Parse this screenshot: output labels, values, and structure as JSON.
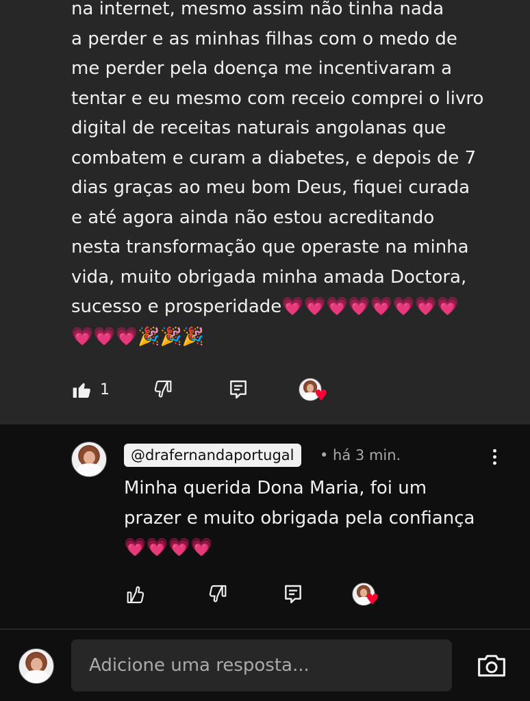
{
  "comment": {
    "text": "na internet, mesmo assim não tinha nada\na perder e as minhas filhas com o medo de\nme perder pela doença me incentivaram a\ntentar e eu mesmo com receio comprei o livro\ndigital de receitas naturais angolanas que\ncombatem e curam a diabetes, e depois de 7\ndias graças ao meu bom Deus, fiquei curada\ne até agora ainda não estou acreditando\nnesta transformação que operaste na minha\nvida, muito obrigada minha amada Doctora,\nsucesso e prosperidade💗💗💗💗💗💗💗💗\n💗💗💗🎉🎉🎉",
    "like_count": "1",
    "icons": [
      "thumbs-up-filled-icon",
      "thumbs-down-icon",
      "reply-comment-icon",
      "creator-heart-avatar"
    ]
  },
  "reply": {
    "handle": "@drafernandaportugal",
    "meta": "• há 3 min.",
    "text": "Minha querida Dona Maria, foi um\nprazer e muito obrigada pela confiança\n💗💗💗💗",
    "icons": [
      "thumbs-up-icon",
      "thumbs-down-icon",
      "reply-comment-icon",
      "creator-heart-avatar"
    ]
  },
  "reply_bar": {
    "placeholder": "Adicione uma resposta..."
  },
  "colors": {
    "background": "#0f0f0f",
    "highlight": "#272727",
    "text": "#f1f1f1",
    "secondary_text": "#aaaaaa",
    "heart": "#ff0033"
  }
}
